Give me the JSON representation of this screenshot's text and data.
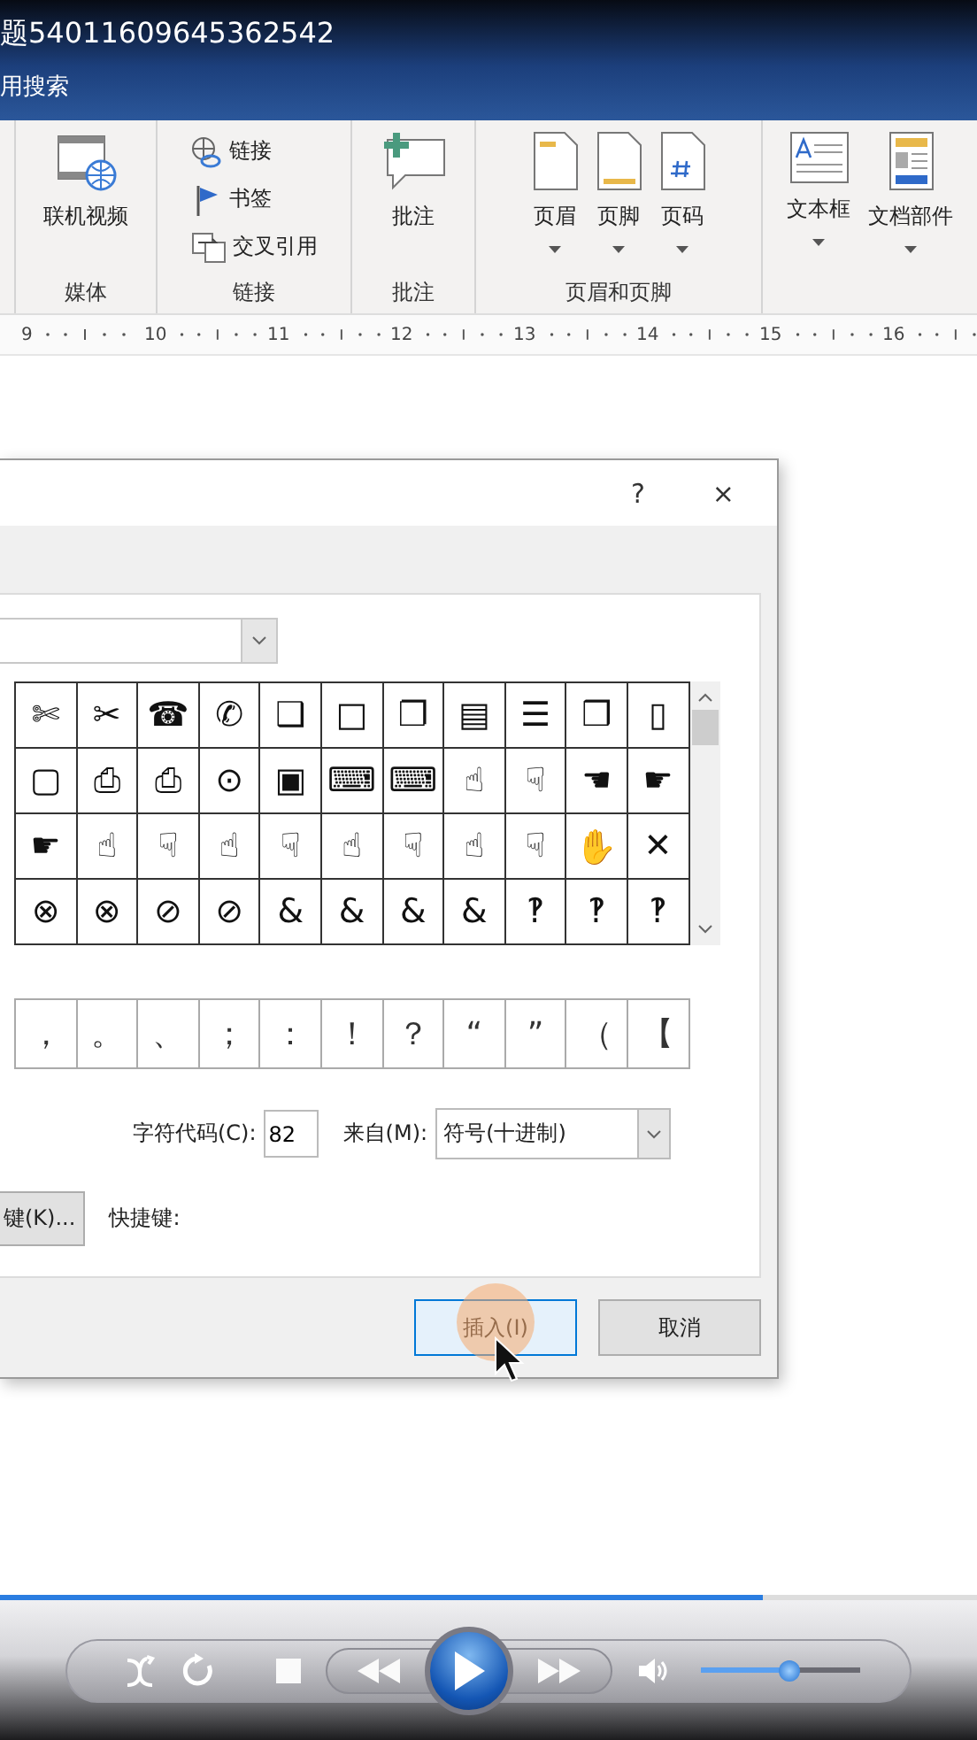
{
  "title_bar": {
    "title": "题54011609645362542",
    "search_hint": "用搜索"
  },
  "ribbon": {
    "groups": [
      {
        "label": "媒体",
        "kind": "row",
        "items": [
          {
            "kind": "video",
            "label": "联机视频",
            "dropdown": false
          }
        ]
      },
      {
        "label": "链接",
        "kind": "stack",
        "items": [
          {
            "kind": "link",
            "label": "链接",
            "dropdown": false
          },
          {
            "kind": "bookmark",
            "label": "书签",
            "dropdown": false
          },
          {
            "kind": "crossref",
            "label": "交叉引用",
            "dropdown": false
          }
        ]
      },
      {
        "label": "批注",
        "kind": "row",
        "items": [
          {
            "kind": "comment",
            "label": "批注",
            "dropdown": false
          }
        ]
      },
      {
        "label": "页眉和页脚",
        "kind": "row",
        "items": [
          {
            "kind": "header",
            "label": "页眉",
            "dropdown": true
          },
          {
            "kind": "footer",
            "label": "页脚",
            "dropdown": true
          },
          {
            "kind": "pagenumber",
            "label": "页码",
            "dropdown": true
          }
        ]
      },
      {
        "kind": "row",
        "items": [
          {
            "kind": "textbox",
            "label": "文本框",
            "dropdown": true
          },
          {
            "kind": "parts",
            "label": "文档部件",
            "dropdown": true
          }
        ]
      }
    ]
  },
  "ruler": {
    "numbers": [
      "9",
      "10",
      "11",
      "12",
      "13",
      "14",
      "15",
      "16"
    ]
  },
  "dialog": {
    "help": "?",
    "close": "×",
    "symbol_rows": [
      [
        "✄",
        "✂",
        "☎",
        "✆",
        "❑",
        "□",
        "❐",
        "▤",
        "☰",
        "❒",
        "▯"
      ],
      [
        "▢",
        "⎙",
        "⎙",
        "⊙",
        "▣",
        "⌨",
        "⌨",
        "☝",
        "☟",
        "☚",
        "☛"
      ],
      [
        "☛",
        "☝",
        "☟",
        "☝",
        "☟",
        "☝",
        "☟",
        "☝",
        "☟",
        "✋",
        "✕"
      ],
      [
        "⊗",
        "⊗",
        "⊘",
        "⊘",
        "&",
        "&",
        "&",
        "&",
        "‽",
        "‽",
        "‽"
      ]
    ],
    "recent_symbols": [
      "，",
      "。",
      "、",
      "；",
      "：",
      "！",
      "？",
      "“",
      "”",
      "（",
      "【"
    ],
    "char_code": {
      "label": "字符代码(C):",
      "value": "82"
    },
    "from": {
      "label": "来自(M):",
      "value": "符号(十进制)"
    },
    "shortcut_button": "键(K)...",
    "shortcut_label": "快捷键:",
    "buttons": [
      {
        "label": "插入(I)",
        "default": true
      },
      {
        "label": "取消",
        "default": false
      }
    ]
  },
  "player": {
    "progress": {
      "level": 0.78
    },
    "volume": {
      "level": 0.55
    }
  }
}
